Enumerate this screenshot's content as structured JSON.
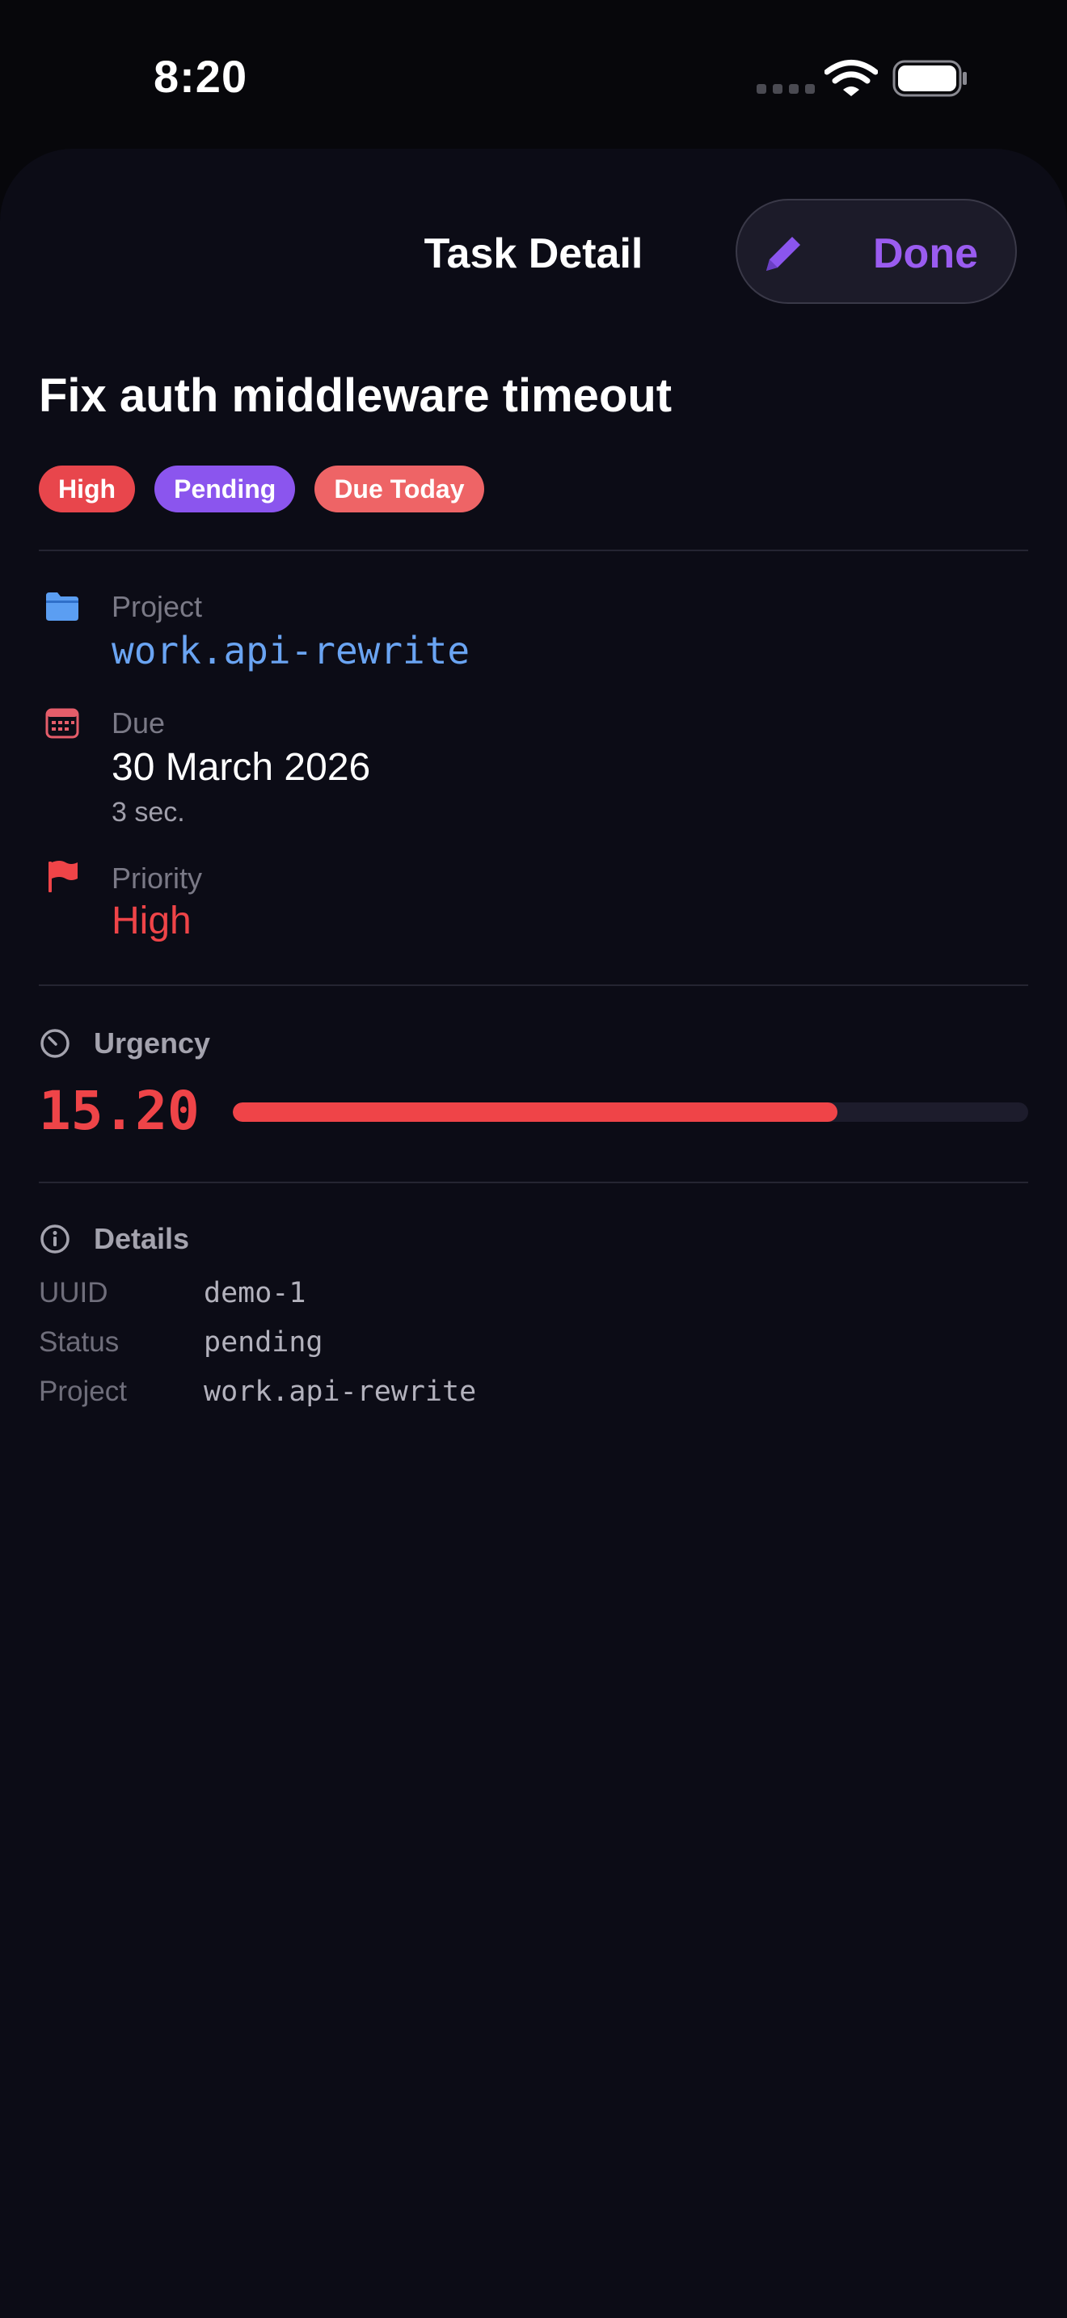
{
  "status_bar": {
    "time": "8:20"
  },
  "nav": {
    "title": "Task Detail",
    "done_label": "Done"
  },
  "task": {
    "title": "Fix auth middleware timeout",
    "badges": {
      "priority": "High",
      "status": "Pending",
      "due": "Due Today"
    }
  },
  "info": {
    "project": {
      "label": "Project",
      "value": "work.api-rewrite",
      "icon": "folder-icon"
    },
    "due": {
      "label": "Due",
      "value": "30 March 2026",
      "relative": "3 sec.",
      "icon": "calendar-icon"
    },
    "priority": {
      "label": "Priority",
      "value": "High",
      "icon": "flag-icon"
    }
  },
  "urgency": {
    "label": "Urgency",
    "value": "15.20",
    "fill_percent": 76
  },
  "details": {
    "label": "Details",
    "rows": [
      {
        "key": "UUID",
        "value": "demo-1"
      },
      {
        "key": "Status",
        "value": "pending"
      },
      {
        "key": "Project",
        "value": "work.api-rewrite"
      }
    ]
  },
  "colors": {
    "background": "#0c0c16",
    "accent": "#9a5cf0",
    "priority_high": "#ef4448",
    "pending": "#8b55ee",
    "due_today": "#ee6466",
    "project_link": "#6aa4f2"
  }
}
